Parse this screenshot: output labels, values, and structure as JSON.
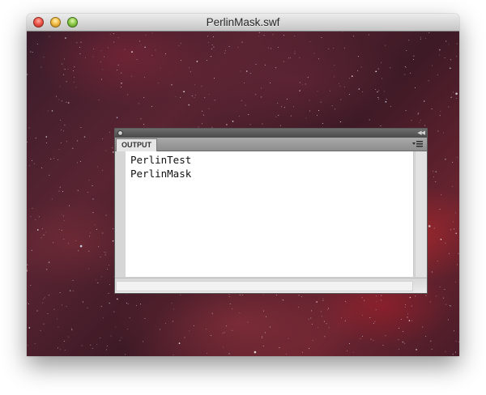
{
  "window": {
    "title": "PerlinMask.swf"
  },
  "stage": {
    "background": "starfield-nebula-image"
  },
  "output_panel": {
    "tab_label": "OUTPUT",
    "collapse_glyph": "◀◀",
    "lines": [
      "PerlinTest",
      "PerlinMask"
    ]
  },
  "colors": {
    "close": "#ef5a4f",
    "minimize": "#f4bf48",
    "zoom": "#8fcc4b",
    "nebula": "#c8283a"
  },
  "icons": {
    "close": "close-button-icon",
    "minimize": "minimize-button-icon",
    "zoom": "zoom-button-icon",
    "panel_menu": "panel-menu-icon"
  }
}
